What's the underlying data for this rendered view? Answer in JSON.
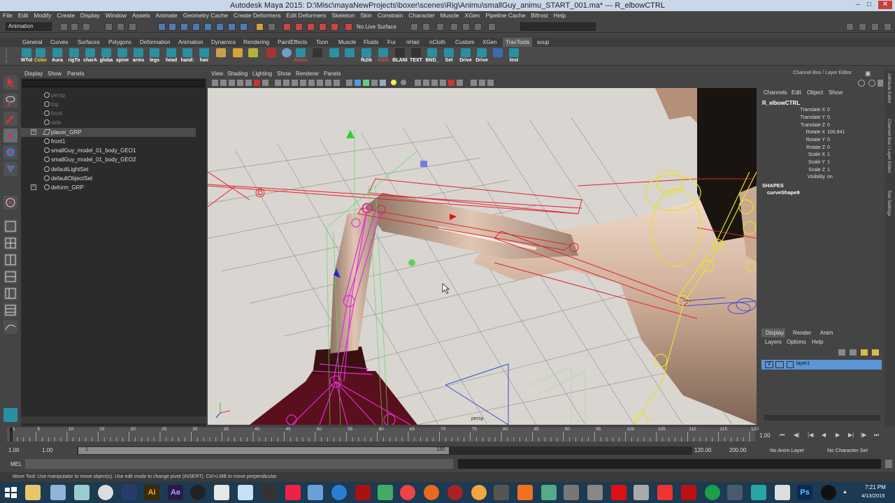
{
  "window": {
    "title": "Autodesk Maya 2015: D:\\Misc\\mayaNewProjects\\boxer\\scenes\\Rig\\Animu\\smallGuy_animu_START_001.ma*   ---   R_elbowCTRL"
  },
  "menu": [
    "File",
    "Edit",
    "Modify",
    "Create",
    "Display",
    "Window",
    "Assets",
    "Animate",
    "Geometry Cache",
    "Create Deformers",
    "Edit Deformers",
    "Skeleton",
    "Skin",
    "Constrain",
    "Character",
    "Muscle",
    "XGen",
    "Pipeline Cache",
    "Bifrost",
    "Help"
  ],
  "statusline": {
    "mode": "Animation",
    "live_surface": "No Live Surface"
  },
  "shelf": {
    "tabs": [
      "General",
      "Curves",
      "Surfaces",
      "Polygons",
      "Deformation",
      "Animation",
      "Dynamics",
      "Rendering",
      "PaintEffects",
      "Toon",
      "Muscle",
      "Fluids",
      "Fur",
      "nHair",
      "nCloth",
      "Custom",
      "XGen",
      "TravTools",
      "soup"
    ],
    "active_tab": "TravTools",
    "buttons": [
      "WTol",
      "Color",
      "Aura",
      "rigTo",
      "charA",
      "globa",
      "spine",
      "arms",
      "legs",
      "head",
      "hand:",
      "hair",
      "",
      "",
      "",
      "Auras",
      "",
      "",
      "",
      "",
      "fk2ik",
      "ik2fk",
      "BLANI",
      "TEXT",
      "BND_",
      "Set",
      "Drive",
      "Drive",
      "",
      "test"
    ]
  },
  "outliner": {
    "menu": [
      "Display",
      "Show",
      "Panels"
    ],
    "rows": [
      {
        "label": "persp",
        "dim": true
      },
      {
        "label": "top",
        "dim": true
      },
      {
        "label": "front",
        "dim": true
      },
      {
        "label": "side",
        "dim": true
      },
      {
        "label": "placer_GRP",
        "expandable": true,
        "selected": true
      },
      {
        "label": "front1"
      },
      {
        "label": "smallGuy_model_01_body_GEO1"
      },
      {
        "label": "smallGuy_model_01_body_GEO2"
      },
      {
        "label": "defaultLightSet"
      },
      {
        "label": "defaultObjectSet"
      },
      {
        "label": "deform_GRP",
        "expandable": true
      }
    ]
  },
  "viewport": {
    "menu": [
      "View",
      "Shading",
      "Lighting",
      "Show",
      "Renderer",
      "Panels"
    ],
    "camera_label": "persp"
  },
  "channelbox": {
    "title": "Channel Box / Layer Editor",
    "menu": [
      "Channels",
      "Edit",
      "Object",
      "Show"
    ],
    "object": "R_elbowCTRL",
    "attributes": [
      {
        "name": "Translate X",
        "value": "0"
      },
      {
        "name": "Translate Y",
        "value": "0"
      },
      {
        "name": "Translate Z",
        "value": "0"
      },
      {
        "name": "Rotate X",
        "value": "100.841"
      },
      {
        "name": "Rotate Y",
        "value": "0"
      },
      {
        "name": "Rotate Z",
        "value": "0"
      },
      {
        "name": "Scale X",
        "value": "1"
      },
      {
        "name": "Scale Y",
        "value": "1"
      },
      {
        "name": "Scale Z",
        "value": "1"
      },
      {
        "name": "Visibility",
        "value": "on"
      }
    ],
    "shapes_header": "SHAPES",
    "shape": "curveShape9"
  },
  "side_tabs": [
    "Attribute Editor",
    "Channel Box / Layer Editor",
    "Tool Settings"
  ],
  "layers": {
    "tabs": [
      "Display",
      "Render",
      "Anim"
    ],
    "active_tab": "Display",
    "menu": [
      "Layers",
      "Options",
      "Help"
    ],
    "layer": {
      "visible": "V",
      "name": "layer1"
    }
  },
  "timeline": {
    "ticks": [
      "1",
      "5",
      "10",
      "15",
      "20",
      "25",
      "30",
      "35",
      "40",
      "45",
      "50",
      "55",
      "60",
      "65",
      "70",
      "75",
      "80",
      "85",
      "90",
      "95",
      "100",
      "105",
      "110",
      "115",
      "120"
    ],
    "current_frame": "1.00",
    "start": "1.00",
    "inner_start": "1.00",
    "range_start": "1",
    "range_end": "120",
    "end": "120.00",
    "anim_end": "200.00",
    "anim_layer": "No Anim Layer",
    "character": "No Character Set"
  },
  "command": {
    "label": "MEL"
  },
  "help_text": "Move Tool: Use manipulator to move object(s). Use edit mode to change pivot (INSERT). Ctrl+LMB to move perpendicular.",
  "taskbar": {
    "time": "7:21 PM",
    "date": "4/13/2015"
  }
}
